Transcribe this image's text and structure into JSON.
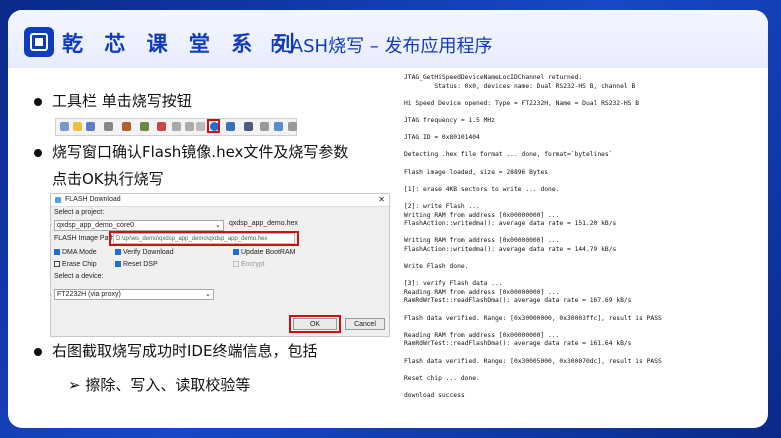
{
  "header": {
    "brand": "乾 芯 课 堂 系 列",
    "title": "FLASH烧写 – 发布应用程序"
  },
  "bullets": {
    "b1": "工具栏 单击烧写按钮",
    "b2": "烧写窗口确认Flash镜像.hex文件及烧写参数",
    "b2b": "点击OK执行烧写",
    "b3": "右图截取烧写成功时IDE终端信息，包括",
    "b3sub": "➢  擦除、写入、读取校验等"
  },
  "dialog": {
    "title": "FLASH Download",
    "close": "✕",
    "select_project_label": "Select a project:",
    "project_value": "qxdsp_app_demo_core0",
    "hex_name": "qxdsp_app_demo.hex",
    "image_path_label": "FLASH Image Path:",
    "image_path_value": "D:\\qx\\ws_demo\\qxdsp_app_demo\\qxdsp_app_demo.hex",
    "dma_mode": "DMA Mode",
    "verify_download": "Verify Download",
    "update_bootram": "Update BootRAM",
    "erase_chip": "Erase Chip",
    "reset_dsp": "Reset DSP",
    "encrypt": "Encrypt",
    "select_device_label": "Select a device:",
    "device_value": "FT2232H (via proxy)",
    "ok": "OK",
    "cancel": "Cancel"
  },
  "terminal": {
    "lines": [
      "JTAG_GetHiSpeedDeviceNameLocIDChannel returned:",
      "        Status: 0x0, devices name: Dual RS232-HS B, channel B",
      "",
      "Hi Speed Device opened: Type = FT2232H, Name = Dual RS232-HS B",
      "",
      "JTAG frequency = 1.5 MHz",
      "",
      "JTAG ID = 0x80101404",
      "",
      "Detecting .hex file format ... done, format=`bytelines`",
      "",
      "Flash image loaded, size = 28896 Bytes",
      "",
      "[1]: erase 4KB sectors to write ... done.",
      "",
      "[2]: write Flash ...",
      "Writing RAM from address [0x00000000] ...",
      "FlashAction::writedma(): average data rate = 151.20 kB/s",
      "",
      "Writing RAM from address [0x00000000] ...",
      "FlashAction::writedma(): average data rate = 144.79 kB/s",
      "",
      "Write Flash done.",
      "",
      "[3]: verify Flash data ...",
      "Reading RAM from address [0x00000000] ...",
      "RamRdWrTest::readFlashDma(): average data rate = 167.69 kB/s",
      "",
      "Flash data verified. Range: [0x30000000, 0x30003ffc], result is PASS",
      "",
      "Reading RAM from address [0x00000000] ...",
      "RamRdWrTest::readFlashDma(): average data rate = 161.64 kB/s",
      "",
      "Flash data verified. Range: [0x30005000, 0x300070dc], result is PASS",
      "",
      "Reset chip ... done.",
      "",
      "download success"
    ]
  },
  "colors": {
    "brand": "#0f3bbd",
    "highlight": "#d01010"
  }
}
